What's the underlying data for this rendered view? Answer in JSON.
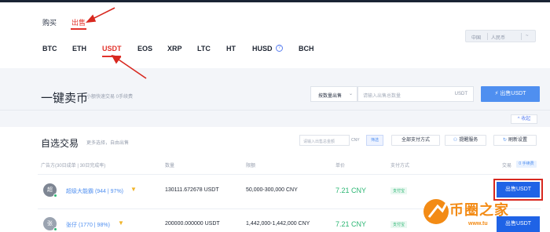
{
  "header": {
    "mode_tabs": [
      {
        "label": "购买",
        "active": false
      },
      {
        "label": "出售",
        "active": true
      }
    ],
    "coin_tabs": [
      {
        "label": "BTC",
        "active": false
      },
      {
        "label": "ETH",
        "active": false
      },
      {
        "label": "USDT",
        "active": true
      },
      {
        "label": "EOS",
        "active": false
      },
      {
        "label": "XRP",
        "active": false
      },
      {
        "label": "LTC",
        "active": false
      },
      {
        "label": "HT",
        "active": false
      },
      {
        "label": "HUSD",
        "active": false,
        "info_icon": "info-icon"
      },
      {
        "label": "BCH",
        "active": false
      }
    ],
    "lang_options": [
      "中国",
      "人民币",
      "~"
    ],
    "accent_color": "#e2322b"
  },
  "quick_sell": {
    "title": "一键卖币",
    "hint": "小额快速交易  0手续费",
    "mode_select": "按数量出售",
    "amount_placeholder": "请输入出售总数量",
    "unit": "USDT",
    "submit_label": "出售USDT",
    "collapse_label": "^ 收起"
  },
  "market": {
    "title": "自选交易",
    "hint": "更多选择，自由出售",
    "filter_placeholder": "请输入出售总金额",
    "filter_currency": "CNY",
    "filter_button": "筛选",
    "pay_methods_button": "全部支付方式",
    "pay_methods_icon": "chevron-down-icon",
    "alert_button": "提醒服务",
    "alert_icon": "bell-icon",
    "refresh_button": "刷新设置",
    "refresh_icon": "refresh-icon",
    "columns": {
      "merchant": "广告方(30日成单 | 30日完成率)",
      "quantity": "数量",
      "limit": "限额",
      "price": "单价",
      "payment": "支付方式",
      "trade": "交易",
      "trade_badge": "0 手续费"
    },
    "rows": [
      {
        "avatar_letter": "超",
        "merchant": "超级大能霸 (944 | 97%)",
        "quantity": "130111.672678 USDT",
        "limit": "50,000-300,000 CNY",
        "price": "7.21 CNY",
        "payment": "支付宝",
        "action": "出售USDT"
      },
      {
        "avatar_letter": "张",
        "merchant": "张仔 (1770 | 98%)",
        "quantity": "200000.000000 USDT",
        "limit": "1,442,000-1,442,000 CNY",
        "price": "7.21 CNY",
        "payment": "支付宝",
        "action": "出售USDT"
      }
    ],
    "price_color": "#2bb673",
    "button_color": "#1f63e6"
  },
  "watermark": {
    "text": "币圈之家",
    "url": "www.tu"
  }
}
